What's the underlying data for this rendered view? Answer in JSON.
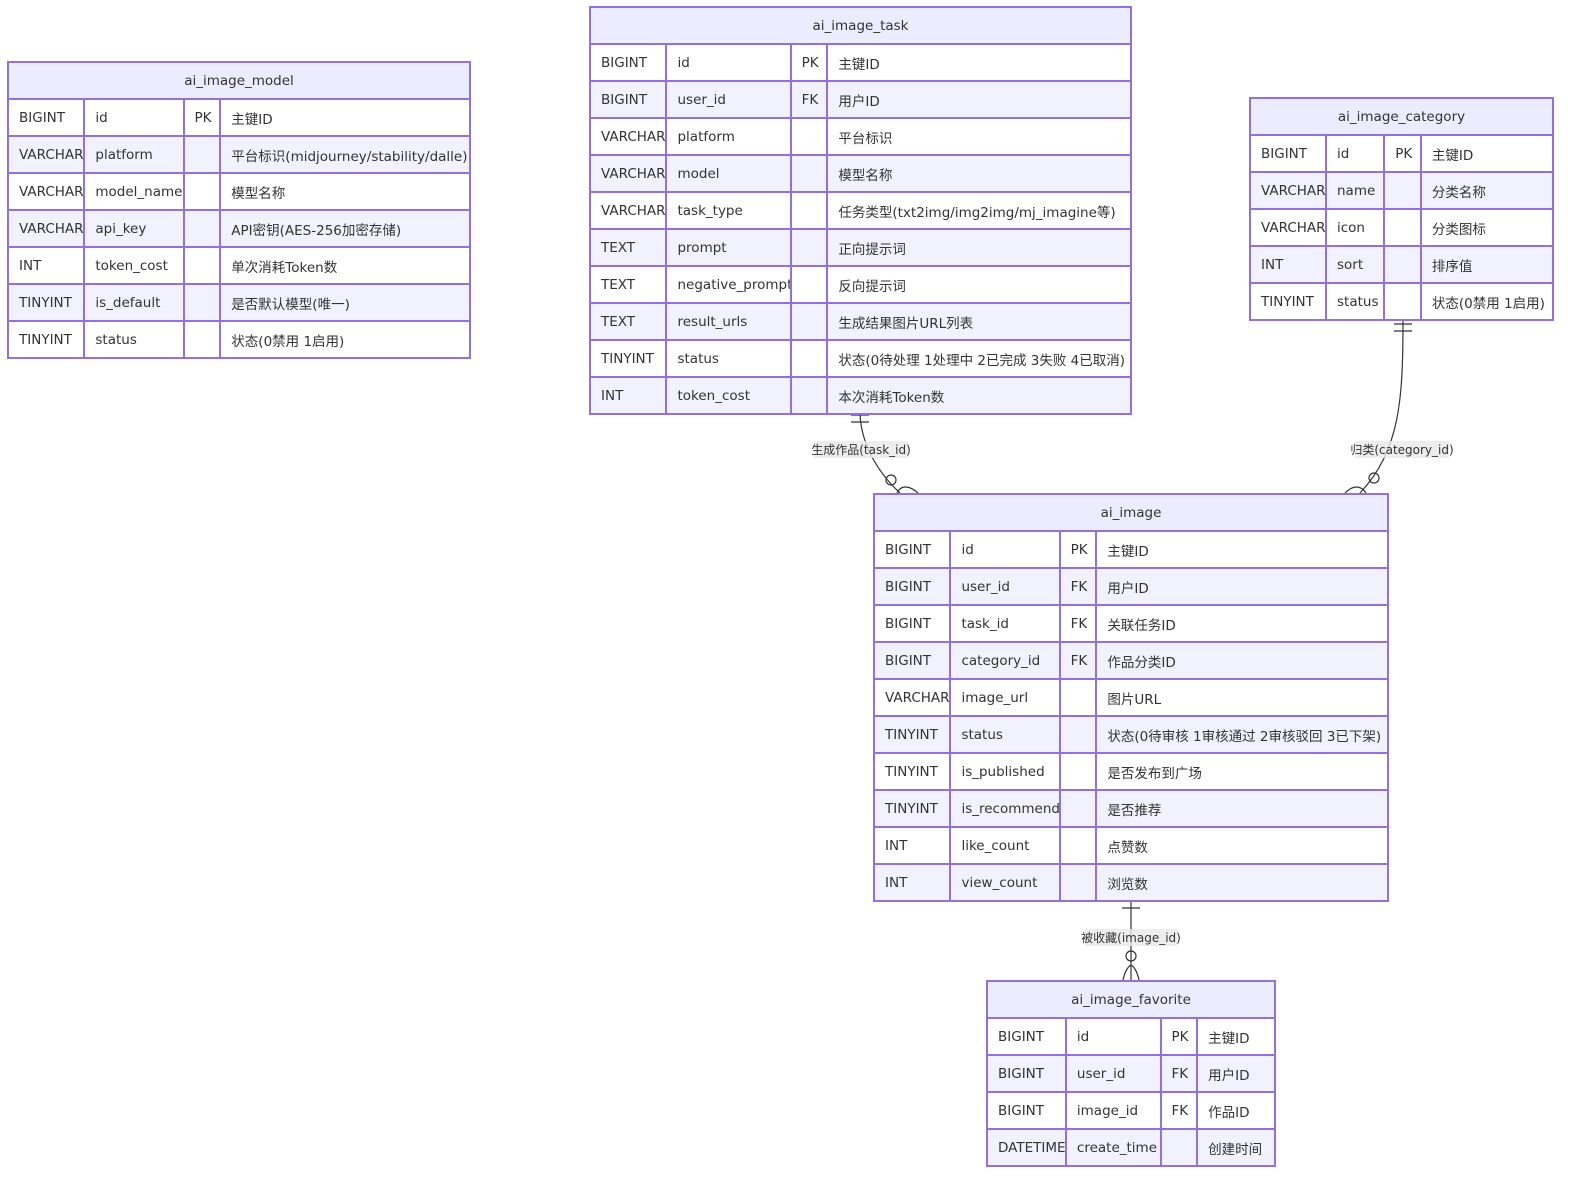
{
  "colors": {
    "border": "#9370DB",
    "header_bg": "#ECECFF",
    "row_alt_bg": "#F2F2FF",
    "line": "#333333",
    "text": "#333333"
  },
  "entities": [
    {
      "key": "ai_image_model",
      "name": "ai_image_model",
      "attributes": [
        {
          "type": "BIGINT",
          "name": "id",
          "key": "PK",
          "comment": "主键ID"
        },
        {
          "type": "VARCHAR",
          "name": "platform",
          "key": "",
          "comment": "平台标识(midjourney/stability/dalle)"
        },
        {
          "type": "VARCHAR",
          "name": "model_name",
          "key": "",
          "comment": "模型名称"
        },
        {
          "type": "VARCHAR",
          "name": "api_key",
          "key": "",
          "comment": "API密钥(AES-256加密存储)"
        },
        {
          "type": "INT",
          "name": "token_cost",
          "key": "",
          "comment": "单次消耗Token数"
        },
        {
          "type": "TINYINT",
          "name": "is_default",
          "key": "",
          "comment": "是否默认模型(唯一)"
        },
        {
          "type": "TINYINT",
          "name": "status",
          "key": "",
          "comment": "状态(0禁用 1启用)"
        }
      ]
    },
    {
      "key": "ai_image_task",
      "name": "ai_image_task",
      "attributes": [
        {
          "type": "BIGINT",
          "name": "id",
          "key": "PK",
          "comment": "主键ID"
        },
        {
          "type": "BIGINT",
          "name": "user_id",
          "key": "FK",
          "comment": "用户ID"
        },
        {
          "type": "VARCHAR",
          "name": "platform",
          "key": "",
          "comment": "平台标识"
        },
        {
          "type": "VARCHAR",
          "name": "model",
          "key": "",
          "comment": "模型名称"
        },
        {
          "type": "VARCHAR",
          "name": "task_type",
          "key": "",
          "comment": "任务类型(txt2img/img2img/mj_imagine等)"
        },
        {
          "type": "TEXT",
          "name": "prompt",
          "key": "",
          "comment": "正向提示词"
        },
        {
          "type": "TEXT",
          "name": "negative_prompt",
          "key": "",
          "comment": "反向提示词"
        },
        {
          "type": "TEXT",
          "name": "result_urls",
          "key": "",
          "comment": "生成结果图片URL列表"
        },
        {
          "type": "TINYINT",
          "name": "status",
          "key": "",
          "comment": "状态(0待处理 1处理中 2已完成 3失败 4已取消)"
        },
        {
          "type": "INT",
          "name": "token_cost",
          "key": "",
          "comment": "本次消耗Token数"
        }
      ]
    },
    {
      "key": "ai_image_category",
      "name": "ai_image_category",
      "attributes": [
        {
          "type": "BIGINT",
          "name": "id",
          "key": "PK",
          "comment": "主键ID"
        },
        {
          "type": "VARCHAR",
          "name": "name",
          "key": "",
          "comment": "分类名称"
        },
        {
          "type": "VARCHAR",
          "name": "icon",
          "key": "",
          "comment": "分类图标"
        },
        {
          "type": "INT",
          "name": "sort",
          "key": "",
          "comment": "排序值"
        },
        {
          "type": "TINYINT",
          "name": "status",
          "key": "",
          "comment": "状态(0禁用 1启用)"
        }
      ]
    },
    {
      "key": "ai_image",
      "name": "ai_image",
      "attributes": [
        {
          "type": "BIGINT",
          "name": "id",
          "key": "PK",
          "comment": "主键ID"
        },
        {
          "type": "BIGINT",
          "name": "user_id",
          "key": "FK",
          "comment": "用户ID"
        },
        {
          "type": "BIGINT",
          "name": "task_id",
          "key": "FK",
          "comment": "关联任务ID"
        },
        {
          "type": "BIGINT",
          "name": "category_id",
          "key": "FK",
          "comment": "作品分类ID"
        },
        {
          "type": "VARCHAR",
          "name": "image_url",
          "key": "",
          "comment": "图片URL"
        },
        {
          "type": "TINYINT",
          "name": "status",
          "key": "",
          "comment": "状态(0待审核 1审核通过 2审核驳回 3已下架)"
        },
        {
          "type": "TINYINT",
          "name": "is_published",
          "key": "",
          "comment": "是否发布到广场"
        },
        {
          "type": "TINYINT",
          "name": "is_recommend",
          "key": "",
          "comment": "是否推荐"
        },
        {
          "type": "INT",
          "name": "like_count",
          "key": "",
          "comment": "点赞数"
        },
        {
          "type": "INT",
          "name": "view_count",
          "key": "",
          "comment": "浏览数"
        }
      ]
    },
    {
      "key": "ai_image_favorite",
      "name": "ai_image_favorite",
      "attributes": [
        {
          "type": "BIGINT",
          "name": "id",
          "key": "PK",
          "comment": "主键ID"
        },
        {
          "type": "BIGINT",
          "name": "user_id",
          "key": "FK",
          "comment": "用户ID"
        },
        {
          "type": "BIGINT",
          "name": "image_id",
          "key": "FK",
          "comment": "作品ID"
        },
        {
          "type": "DATETIME",
          "name": "create_time",
          "key": "",
          "comment": "创建时间"
        }
      ]
    }
  ],
  "relationships": [
    {
      "from": "ai_image_task",
      "to": "ai_image",
      "label": "生成作品(task_id)",
      "from_card": "exactly-one",
      "to_card": "zero-or-many"
    },
    {
      "from": "ai_image_category",
      "to": "ai_image",
      "label": "归类(category_id)",
      "from_card": "exactly-one",
      "to_card": "zero-or-many"
    },
    {
      "from": "ai_image",
      "to": "ai_image_favorite",
      "label": "被收藏(image_id)",
      "from_card": "exactly-one",
      "to_card": "zero-or-many"
    }
  ]
}
